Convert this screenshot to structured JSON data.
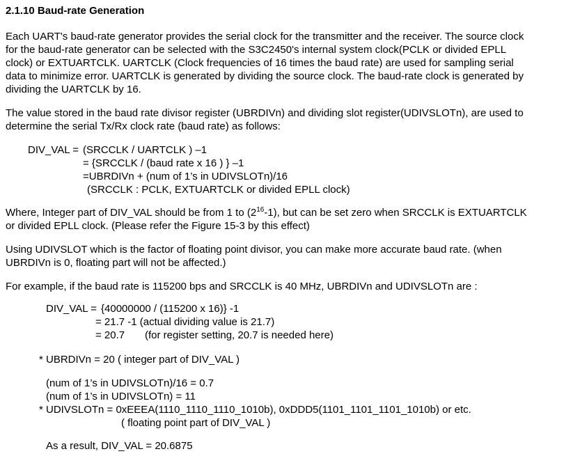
{
  "section": {
    "number": "2.1.10",
    "title": "Baud-rate Generation"
  },
  "intro": {
    "lines": [
      "Each UART's baud-rate generator provides the serial clock for the transmitter and the receiver. The source clock",
      "for the baud-rate generator can be selected with the S3C2450's internal system clock(PCLK or divided EPLL",
      "clock) or EXTUARTCLK. UARTCLK (Clock frequencies of 16 times the baud rate) are used for sampling serial",
      "data to minimize error. UARTCLK is generated by dividing the source clock. The baud-rate clock is generated by",
      "dividing the UARTCLK by 16."
    ]
  },
  "divisor_para": {
    "lines": [
      "The value stored in the baud rate divisor register (UBRDIVn) and dividing slot register(UDIVSLOTn), are used to",
      "determine the serial Tx/Rx clock rate (baud rate) as follows:"
    ]
  },
  "formula": {
    "lhs": "DIV_VAL = ",
    "line1": "(SRCCLK / UARTCLK ) –1",
    "line2": "= {SRCCLK / (baud rate x 16 ) } –1",
    "line3": "=UBRDIVn + (num of 1’s in UDIVSLOTn)/16",
    "line4": "(SRCCLK : PCLK, EXTUARTCLK or divided EPLL clock)"
  },
  "where_para": {
    "prefix": "Where, Integer part of DIV_VAL should be from 1 to (2",
    "exponent": "16",
    "suffix": "-1), but can be set zero when SRCCLK is EXTUARTCLK",
    "line2": "or divided EPLL clock. (Please refer the Figure 15-3 by this effect)"
  },
  "udivslot_para": {
    "lines": [
      "Using UDIVSLOT which is the factor of floating point divisor, you can make more accurate baud rate. (when",
      "UBRDIVn is 0, floating part will not be affected.)"
    ]
  },
  "example_para": {
    "text": "For example, if the baud rate is 115200 bps and SRCCLK is 40 MHz, UBRDIVn and UDIVSLOTn are :"
  },
  "example_calc": {
    "lhs": "DIV_VAL = ",
    "line1": "{40000000 / (115200 x 16)} -1",
    "line2": "= 21.7 -1 (actual dividing value is 21.7)",
    "line3_value": "= 20.7",
    "line3_note": "(for register setting, 20.7 is needed here)"
  },
  "ubrdiv_note": "* UBRDIVn = 20 ( integer part of DIV_VAL )",
  "slot_calc": {
    "line1": "(num of 1’s in UDIVSLOTn)/16 = 0.7",
    "line2": "(num of 1’s in UDIVSLOTn) = 11",
    "line3": "* UDIVSLOTn = 0xEEEA(1110_1110_1110_1010b), 0xDDD5(1101_1101_1101_1010b) or etc.",
    "line4": "( floating point part of DIV_VAL )"
  },
  "result": "As a result, DIV_VAL = 20.6875"
}
